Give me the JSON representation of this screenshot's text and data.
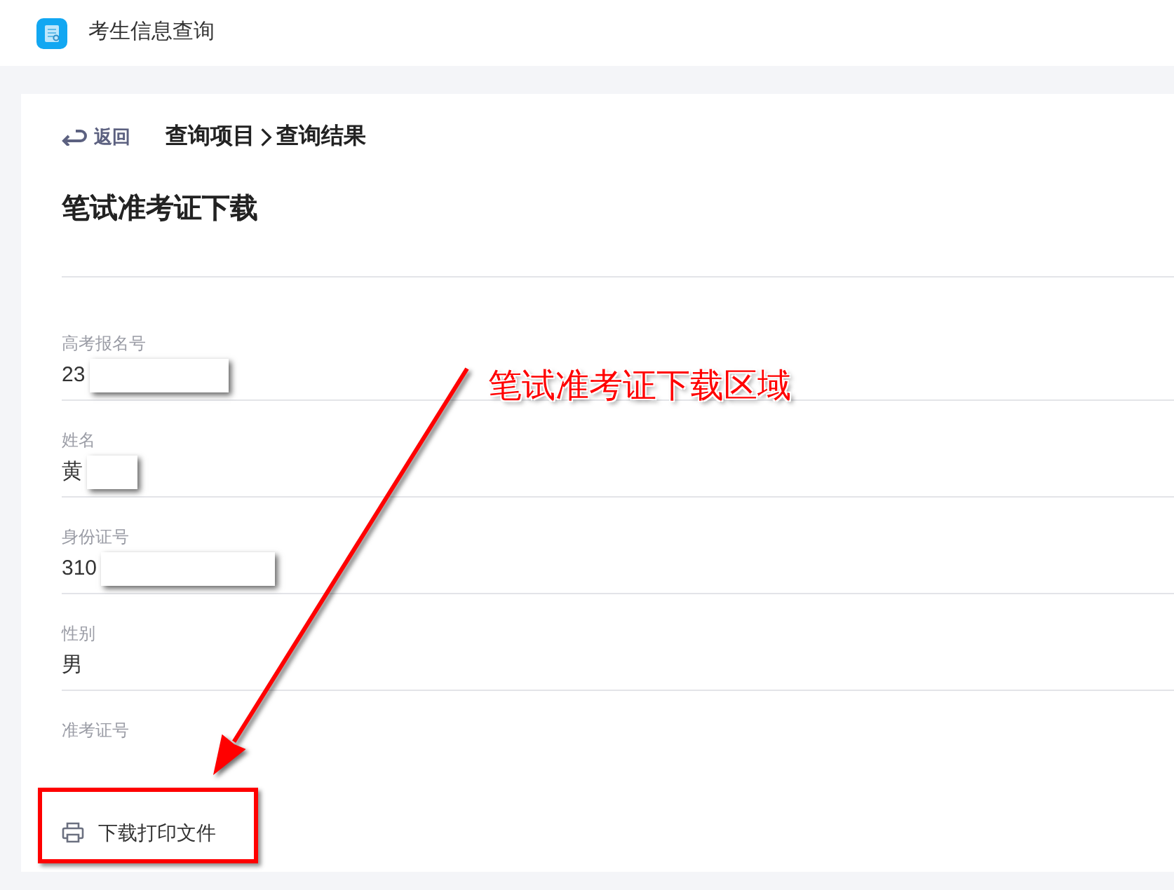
{
  "app": {
    "title": "考生信息查询"
  },
  "breadcrumb": {
    "back": "返回",
    "items": [
      "查询项目",
      "查询结果"
    ]
  },
  "page_title": "笔试准考证下载",
  "fields": [
    {
      "label": "高考报名号",
      "value": "23",
      "redacted": true
    },
    {
      "label": "姓名",
      "value": "黄",
      "redacted": true
    },
    {
      "label": "身份证号",
      "value": "310",
      "redacted": true
    },
    {
      "label": "性别",
      "value": "男"
    },
    {
      "label": "准考证号"
    }
  ],
  "download_button": {
    "label": "下载打印文件"
  },
  "annotation": {
    "text": "笔试准考证下载区域"
  }
}
